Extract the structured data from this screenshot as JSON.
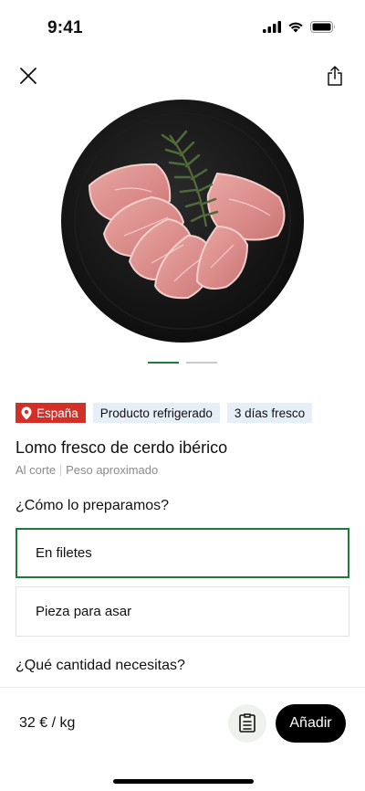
{
  "status_bar": {
    "time": "9:41"
  },
  "header": {
    "close_icon": "close-icon",
    "share_icon": "share-icon"
  },
  "product": {
    "image_alt": "Lomo fresco de cerdo ibérico",
    "tags": {
      "origin": "España",
      "storage": "Producto refrigerado",
      "freshness": "3 días fresco"
    },
    "title": "Lomo fresco de cerdo ibérico",
    "subtitle_cut": "Al corte",
    "subtitle_weight": "Peso aproximado"
  },
  "preparation": {
    "label": "¿Cómo lo preparamos?",
    "options": [
      {
        "label": "En filetes",
        "selected": true
      },
      {
        "label": "Pieza para asar",
        "selected": false
      }
    ]
  },
  "quantity": {
    "label": "¿Qué cantidad necesitas?"
  },
  "bottom_bar": {
    "price": "32 € / kg",
    "add_label": "Añadir"
  },
  "colors": {
    "accent": "#1e7a36",
    "origin_tag": "#d22f27",
    "tag_bg": "#e6eef8"
  }
}
